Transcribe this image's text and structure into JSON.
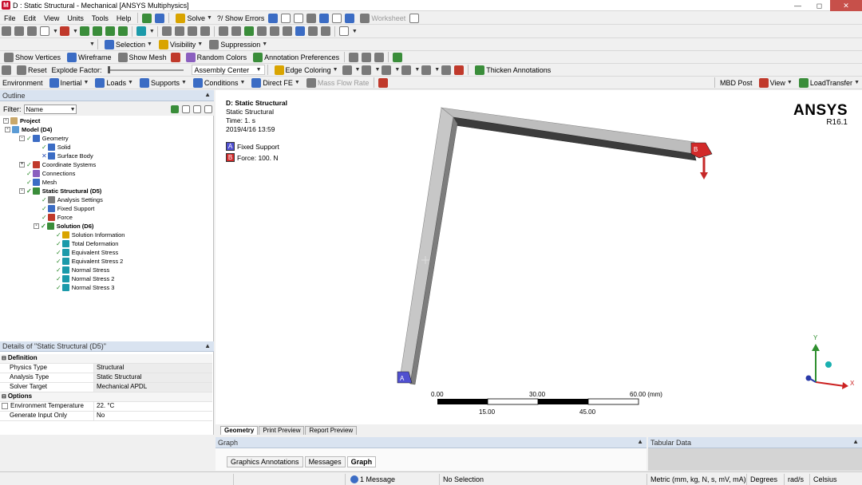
{
  "window": {
    "title": "D : Static Structural - Mechanical [ANSYS Multiphysics]",
    "app_icon_letter": "M"
  },
  "menu": [
    "File",
    "Edit",
    "View",
    "Units",
    "Tools",
    "Help"
  ],
  "toolbar1": {
    "solve": "Solve",
    "show_errors": "?/ Show Errors",
    "worksheet": "Worksheet"
  },
  "toolbar2": {
    "selection": "Selection",
    "visibility": "Visibility",
    "suppression": "Suppression"
  },
  "toolbar3": {
    "show_vertices": "Show Vertices",
    "wireframe": "Wireframe",
    "show_mesh": "Show Mesh",
    "random_colors": "Random Colors",
    "annotation_prefs": "Annotation Preferences"
  },
  "toolbar4": {
    "reset": "Reset",
    "explode_factor": "Explode Factor:",
    "assembly_center": "Assembly Center",
    "edge_coloring": "Edge Coloring",
    "thicken_annotations": "Thicken Annotations"
  },
  "context_toolbar": {
    "environment": "Environment",
    "inertial": "Inertial",
    "loads": "Loads",
    "supports": "Supports",
    "conditions": "Conditions",
    "direct_fe": "Direct FE",
    "mass_flow_rate": "Mass Flow Rate",
    "mbd_post": "MBD Post",
    "view": "View",
    "load_transfer": "LoadTransfer"
  },
  "outline": {
    "header": "Outline",
    "filter_label": "Filter:",
    "filter_value": "Name",
    "tree": [
      {
        "label": "Project",
        "bold": true
      },
      {
        "label": "Model (D4)",
        "bold": true
      },
      {
        "label": "Geometry",
        "bold": false
      },
      {
        "label": "Solid",
        "bold": false
      },
      {
        "label": "Surface Body",
        "bold": false
      },
      {
        "label": "Coordinate Systems",
        "bold": false
      },
      {
        "label": "Connections",
        "bold": false
      },
      {
        "label": "Mesh",
        "bold": false
      },
      {
        "label": "Static Structural (D5)",
        "bold": true
      },
      {
        "label": "Analysis Settings",
        "bold": false
      },
      {
        "label": "Fixed Support",
        "bold": false
      },
      {
        "label": "Force",
        "bold": false
      },
      {
        "label": "Solution (D6)",
        "bold": true
      },
      {
        "label": "Solution Information",
        "bold": false
      },
      {
        "label": "Total Deformation",
        "bold": false
      },
      {
        "label": "Equivalent Stress",
        "bold": false
      },
      {
        "label": "Equivalent Stress 2",
        "bold": false
      },
      {
        "label": "Normal Stress",
        "bold": false
      },
      {
        "label": "Normal Stress 2",
        "bold": false
      },
      {
        "label": "Normal Stress 3",
        "bold": false
      }
    ]
  },
  "details": {
    "header": "Details of \"Static Structural (D5)\"",
    "sections": {
      "definition": "Definition",
      "options": "Options"
    },
    "rows": {
      "physics_type": {
        "k": "Physics Type",
        "v": "Structural"
      },
      "analysis_type": {
        "k": "Analysis Type",
        "v": "Static Structural"
      },
      "solver_target": {
        "k": "Solver Target",
        "v": "Mechanical APDL"
      },
      "env_temp": {
        "k": "Environment Temperature",
        "v": "22. °C"
      },
      "gen_input": {
        "k": "Generate Input Only",
        "v": "No"
      }
    }
  },
  "graphics": {
    "title": "D: Static Structural",
    "subtitle": "Static Structural",
    "time": "Time: 1. s",
    "date": "2019/4/16 13:59",
    "legend": [
      {
        "tag": "A",
        "label": "Fixed Support",
        "color": "#4f4fd1"
      },
      {
        "tag": "B",
        "label": "Force: 100. N",
        "color": "#d22a2a"
      }
    ],
    "logo": "ANSYS",
    "version": "R16.1",
    "scale": {
      "top_labels": [
        "0.00",
        "30.00",
        "60.00 (mm)"
      ],
      "bottom_labels": [
        "15.00",
        "45.00"
      ]
    },
    "axes": {
      "x": "X",
      "y": "Y"
    }
  },
  "view_tabs": [
    "Geometry",
    "Print Preview",
    "Report Preview"
  ],
  "graph_panel": {
    "header": "Graph",
    "tabs": [
      "Graphics Annotations",
      "Messages",
      "Graph"
    ]
  },
  "tabular_panel": {
    "header": "Tabular Data"
  },
  "status": {
    "messages": "1 Message",
    "selection": "No Selection",
    "units": "Metric (mm, kg, N, s, mV, mA)",
    "angle": "Degrees",
    "rot": "rad/s",
    "temp": "Celsius"
  }
}
